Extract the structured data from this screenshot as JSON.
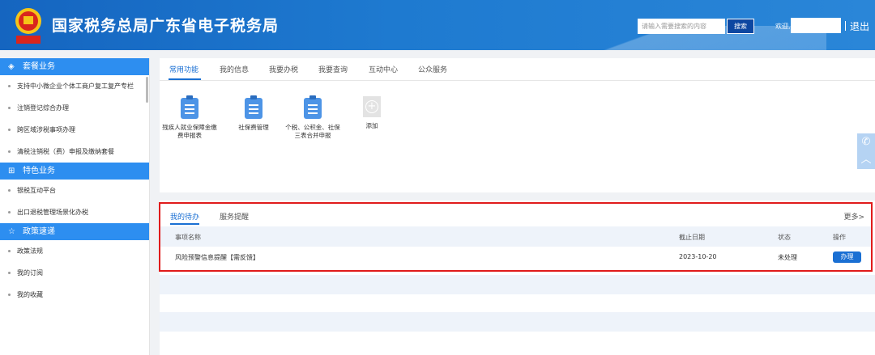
{
  "header": {
    "title": "国家税务总局广东省电子税务局",
    "search_placeholder": "请输入需要搜索的内容",
    "search_button": "搜索",
    "welcome": "欢迎,",
    "logout": "退出",
    "brand_color": "#1e7ad0"
  },
  "sidebar": {
    "sections": [
      {
        "title": "套餐业务",
        "icon": "layers-icon",
        "items": [
          "支持中小微企业个体工商户复工复产专栏",
          "注销登记综合办理",
          "跨区域涉税事项办理",
          "清税注销税（费）申报及缴纳套餐"
        ]
      },
      {
        "title": "特色业务",
        "icon": "grid-icon",
        "items": [
          "银税互动平台",
          "出口退税管理场景化办税"
        ]
      },
      {
        "title": "政策速递",
        "icon": "star-icon",
        "items": [
          "政策法规",
          "我的订阅",
          "我的收藏"
        ]
      }
    ]
  },
  "main": {
    "tabs": [
      "常用功能",
      "我的信息",
      "我要办税",
      "我要查询",
      "互动中心",
      "公众服务"
    ],
    "active_tab": "常用功能",
    "functions": [
      {
        "label": "残疾人就业保障金缴费申报表",
        "icon": "document-icon"
      },
      {
        "label": "社保费管理",
        "icon": "document-icon"
      },
      {
        "label": "个税、公积金、社保三表合并申报",
        "icon": "document-icon"
      },
      {
        "label": "添加",
        "icon": "add-icon"
      }
    ]
  },
  "todo": {
    "tabs": [
      "我的待办",
      "服务提醒"
    ],
    "more": "更多>",
    "columns": [
      "事项名称",
      "截止日期",
      "状态",
      "操作"
    ],
    "rows": [
      {
        "name": "风险预警信息提醒【需反馈】",
        "deadline": "2023-10-20",
        "status": "未处理",
        "action": "办理"
      }
    ],
    "highlight_color": "#e01b1b"
  }
}
